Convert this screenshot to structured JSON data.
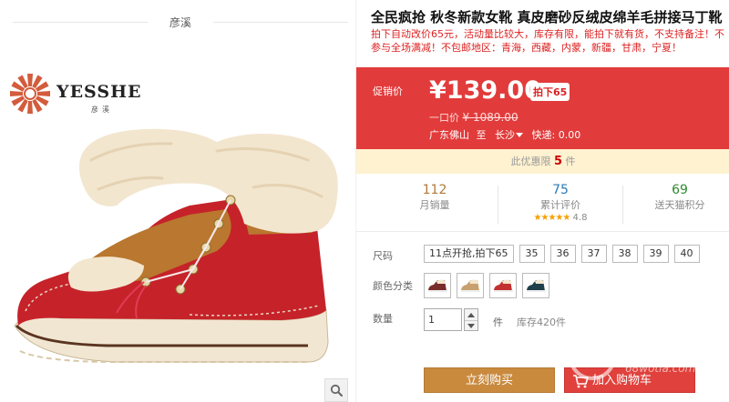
{
  "gallery": {
    "brand_top": "彦溪",
    "logo_text": "YESSHE",
    "logo_sub": "彦溪"
  },
  "product": {
    "title": "全民疯抢 秋冬新款女靴 真皮磨砂反绒皮绵羊毛拼接马丁靴",
    "subtitle": "拍下自动改价65元，活动量比较大，库存有限，能拍下就有货，不支持备注！不参与全场满减！不包邮地区：青海，西藏，内蒙，新疆，甘肃，宁夏！"
  },
  "price": {
    "label": "促销价",
    "current": "¥139.00",
    "tag": "拍下65",
    "original_label": "一口价",
    "original_price": "¥ 1089.00",
    "origin": "广东佛山",
    "to": "至",
    "destination": "长沙",
    "express_label": "快递:",
    "express_fee": "0.00"
  },
  "limit": {
    "prefix": "此优惠限",
    "count": "5",
    "suffix": "件"
  },
  "stats": {
    "monthly_sales_value": "112",
    "monthly_sales_label": "月销量",
    "reviews_value": "75",
    "reviews_label": "累计评价",
    "rating": "4.8",
    "points_value": "69",
    "points_label": "送天猫积分"
  },
  "options": {
    "size_label": "尺码",
    "sizes": [
      "11点开抢,拍下65",
      "35",
      "36",
      "37",
      "38",
      "39",
      "40"
    ],
    "color_label": "颜色分类",
    "colors": [
      "#7a2b2b",
      "#c8a070",
      "#c23030",
      "#1f3f4a"
    ]
  },
  "quantity": {
    "label": "数量",
    "value": "1",
    "unit": "件",
    "stock": "库存420件"
  },
  "actions": {
    "buy_label": "立刻购买",
    "cart_label": "加入购物车"
  },
  "watermark": {
    "text": "68游戏",
    "url": "68wotia.com"
  },
  "icons": {
    "zoom": "search-icon",
    "cart": "cart-icon",
    "step_up": "caret-up-icon",
    "step_down": "caret-down-icon",
    "destination": "caret-down-icon"
  },
  "colors_theme": {
    "price_bg": "#e23b3b",
    "buy_button": "#c98a3e",
    "cart_button": "#e0413c",
    "limit_bg": "#fff2d0"
  }
}
